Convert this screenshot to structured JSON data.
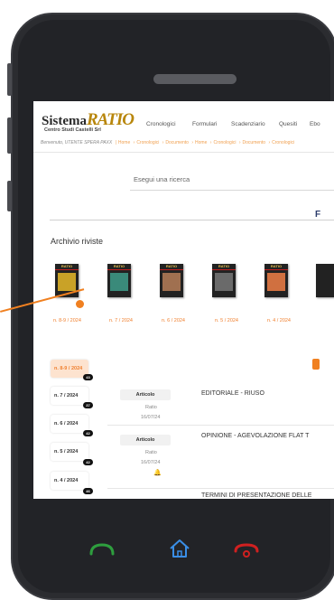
{
  "header": {
    "logo_brand": "Sistema",
    "logo_ratio": "RATIO",
    "logo_sub": "Centro Studi Castelli Srl",
    "nav": [
      "Cronologici",
      "Formulari",
      "Scadenziario",
      "Quesiti",
      "Ebo"
    ],
    "welcome": "Benvenuto, UTENTE SPERA PAXX",
    "breadcrumb": [
      "Home",
      "Cronologici",
      "Documento",
      "Home",
      "Cronologici",
      "Documento",
      "Cronologici"
    ]
  },
  "search": {
    "placeholder": "Esegui una ricerca"
  },
  "archive": {
    "title": "Archivio riviste",
    "covers": [
      {
        "label": "n. 8-9 / 2024",
        "accent": "#c9a227"
      },
      {
        "label": "n. 7 / 2024",
        "accent": "#3a8a7a"
      },
      {
        "label": "n. 6 / 2024",
        "accent": "#a07050"
      },
      {
        "label": "n. 5 / 2024",
        "accent": "#6a6a6a"
      },
      {
        "label": "n. 4 / 2024",
        "accent": "#d07040"
      }
    ],
    "cover_band": "RATIO"
  },
  "issues": [
    {
      "label": "n. 8-9 / 2024",
      "count": "43",
      "active": true
    },
    {
      "label": "n. 7 / 2024",
      "count": "37",
      "active": false
    },
    {
      "label": "n. 6 / 2024",
      "count": "42",
      "active": false
    },
    {
      "label": "n. 5 / 2024",
      "count": "42",
      "active": false
    },
    {
      "label": "n. 4 / 2024",
      "count": "46",
      "active": false
    }
  ],
  "articles": [
    {
      "type": "Articolo",
      "source": "Ratio",
      "date": "16/07/24",
      "title": "EDITORIALE - RIUSO"
    },
    {
      "type": "Articolo",
      "source": "Ratio",
      "date": "16/07/24",
      "title": "OPINIONE - AGEVOLAZIONE FLAT T"
    },
    {
      "type": "Articolo",
      "source": "",
      "date": "",
      "title": "TERMINI DI PRESENTAZIONE DELLE"
    }
  ],
  "right_glyph": "F",
  "phone_buttons": {
    "call": "call-icon",
    "home": "home-icon",
    "hangup": "hangup-icon"
  },
  "colors": {
    "accent": "#f08030",
    "brand_gold": "#b8860b",
    "active_bg": "#fde3cf"
  }
}
